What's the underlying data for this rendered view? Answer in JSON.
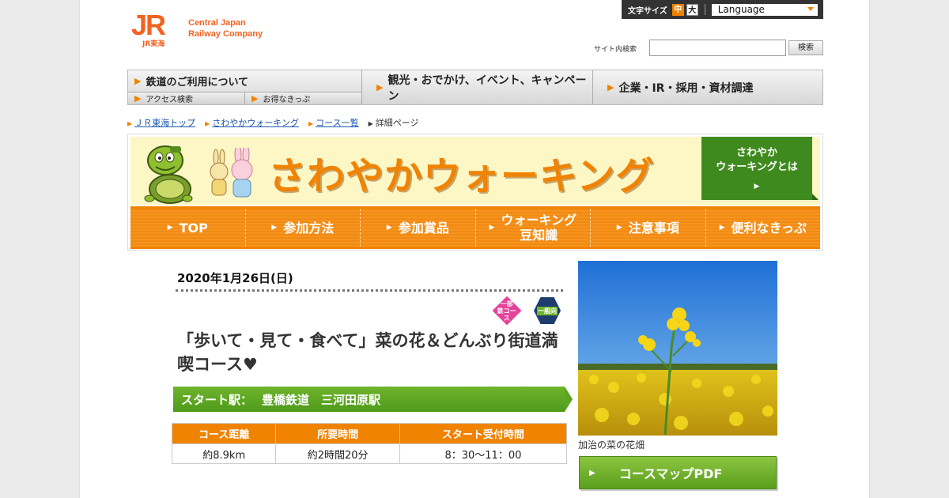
{
  "header": {
    "logo_mark": "JR",
    "logo_sub": "JR東海",
    "logo_line1": "Central Japan",
    "logo_line2": "Railway Company",
    "font_size_label": "文字サイズ",
    "font_size_mid": "中",
    "font_size_big": "大",
    "language_label": "Language",
    "search_label": "サイト内検索",
    "search_value": "",
    "search_button": "検索"
  },
  "mainnav": {
    "group1_title": "鉄道のご利用について",
    "sub1": "アクセス検索",
    "sub2": "お得なきっぷ",
    "item2": "観光・おでかけ、イベント、キャンペーン",
    "item3": "企業・IR・採用・資材調達"
  },
  "breadcrumb": {
    "item1": "ＪＲ東海トップ",
    "item2": "さわやかウォーキング",
    "item3": "コース一覧",
    "current": "詳細ページ"
  },
  "banner": {
    "title": "さわやかウォーキング",
    "about_line1": "さわやか",
    "about_line2": "ウォーキングとは",
    "subnav": [
      "TOP",
      "参加方法",
      "参加賞品",
      "ウォーキング豆知識",
      "注意事項",
      "便利なきっぷ"
    ],
    "subnav_line1": "ウォーキング",
    "subnav_line2": "豆知識"
  },
  "content": {
    "date": "2020年1月26日(日)",
    "badge1": "一部 鉄コース",
    "badge2": "一般向",
    "course_title": "「歩いて・見て・食べて」菜の花＆どんぶり街道満喫コース♥",
    "start_label": "スタート駅：",
    "start_station": "豊橋鉄道　三河田原駅",
    "table_headers": [
      "コース距離",
      "所要時間",
      "スタート受付時間"
    ],
    "table_values": [
      "約8.9km",
      "約2時間20分",
      "8：30～11：00"
    ],
    "photo_caption": "加治の菜の花畑",
    "pdf_button": "コースマップPDF"
  },
  "colors": {
    "jr_orange": "#f26322",
    "accent_orange": "#f08300",
    "green": "#5aa622",
    "link_blue": "#1a56b0"
  }
}
